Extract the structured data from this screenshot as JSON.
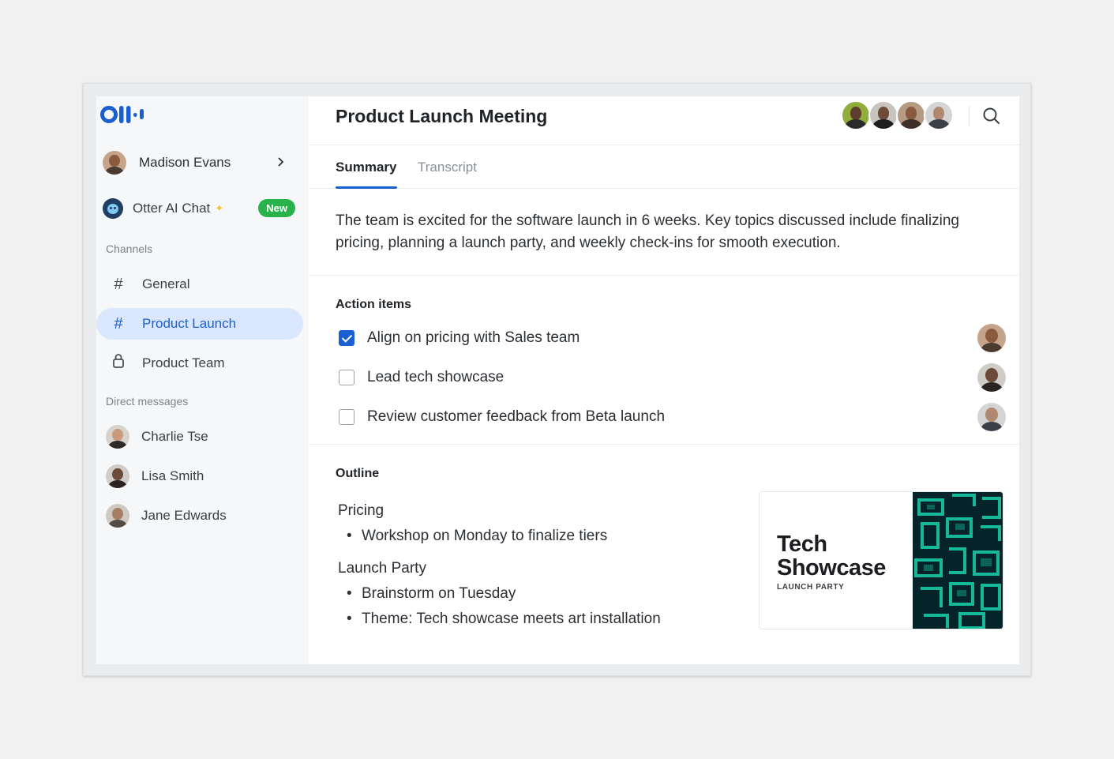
{
  "app": {
    "logo": "Otter"
  },
  "sidebar": {
    "user": {
      "name": "Madison Evans"
    },
    "ai_chat": {
      "label": "Otter AI Chat",
      "badge": "New"
    },
    "channels_label": "Channels",
    "channels": [
      {
        "label": "General",
        "icon": "hash-icon"
      },
      {
        "label": "Product Launch",
        "icon": "hash-icon",
        "active": true
      },
      {
        "label": "Product Team",
        "icon": "lock-icon"
      }
    ],
    "dm_label": "Direct messages",
    "direct_messages": [
      {
        "label": "Charlie Tse"
      },
      {
        "label": "Lisa Smith"
      },
      {
        "label": "Jane Edwards"
      }
    ]
  },
  "meeting": {
    "title": "Product Launch Meeting",
    "tabs": [
      {
        "label": "Summary",
        "active": true
      },
      {
        "label": "Transcript",
        "active": false
      }
    ],
    "summary": "The team is excited for the software launch in 6 weeks. Key topics discussed include finalizing pricing, planning a launch party, and weekly check-ins for smooth execution.",
    "action_items_label": "Action items",
    "action_items": [
      {
        "label": "Align on pricing with Sales team",
        "checked": true
      },
      {
        "label": "Lead tech showcase",
        "checked": false
      },
      {
        "label": "Review customer feedback from Beta launch",
        "checked": false
      }
    ],
    "outline_label": "Outline",
    "outline": [
      {
        "heading": "Pricing",
        "bullets": [
          "Workshop on Monday to finalize tiers"
        ]
      },
      {
        "heading": "Launch Party",
        "bullets": [
          "Brainstorm on Tuesday",
          "Theme: Tech showcase meets art installation"
        ]
      }
    ],
    "card": {
      "line1": "Tech",
      "line2": "Showcase",
      "sub": "LAUNCH PARTY"
    }
  },
  "colors": {
    "accent": "#1a5fd1",
    "active_bg": "#dbe6ff",
    "badge": "#28b34a",
    "card_art": "#19c9a6"
  }
}
